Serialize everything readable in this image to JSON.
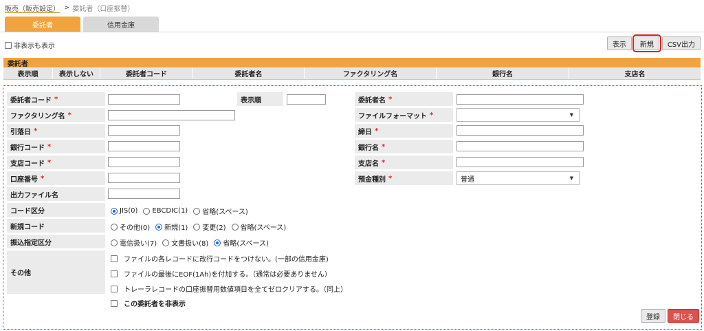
{
  "breadcrumb": {
    "parent": "販売（販売設定）",
    "sep": ">",
    "current": "委託者（口座振替）"
  },
  "tabs": [
    {
      "label": "委託者"
    },
    {
      "label": "信用金庫"
    }
  ],
  "show_hidden": {
    "label": "非表示も表示"
  },
  "toolbar": {
    "display": "表示",
    "new": "新規",
    "csv": "CSV出力"
  },
  "list": {
    "title": "委託者",
    "columns": [
      "表示順",
      "表示しない",
      "委託者コード",
      "委託者名",
      "ファクタリング名",
      "銀行名",
      "支店名"
    ]
  },
  "form": {
    "consignor_code": {
      "label": "委託者コード",
      "required": "*",
      "value": ""
    },
    "display_order": {
      "label": "表示順",
      "value": ""
    },
    "consignor_name": {
      "label": "委託者名",
      "required": "*",
      "value": ""
    },
    "factoring_name": {
      "label": "ファクタリング名",
      "required": "*",
      "value": ""
    },
    "file_format": {
      "label": "ファイルフォーマット",
      "required": "*",
      "value": ""
    },
    "debit_date": {
      "label": "引落日",
      "required": "*",
      "value": ""
    },
    "closing_date": {
      "label": "締日",
      "required": "*",
      "value": ""
    },
    "bank_code": {
      "label": "銀行コード",
      "required": "*",
      "value": ""
    },
    "bank_name": {
      "label": "銀行名",
      "required": "*",
      "value": ""
    },
    "branch_code": {
      "label": "支店コード",
      "required": "*",
      "value": ""
    },
    "branch_name": {
      "label": "支店名",
      "required": "*",
      "value": ""
    },
    "account_number": {
      "label": "口座番号",
      "required": "*",
      "value": ""
    },
    "deposit_type": {
      "label": "預金種別",
      "required": "*",
      "value": "普通"
    },
    "output_filename": {
      "label": "出力ファイル名",
      "value": ""
    },
    "code_type": {
      "label": "コード区分",
      "options": [
        "JIS(0)",
        "EBCDIC(1)",
        "省略(スペース)"
      ],
      "selected": "JIS(0)"
    },
    "new_code": {
      "label": "新規コード",
      "options": [
        "その他(0)",
        "新規(1)",
        "変更(2)",
        "省略(スペース)"
      ],
      "selected": "新規(1)"
    },
    "transfer_type": {
      "label": "振込指定区分",
      "options": [
        "電信扱い(7)",
        "文書扱い(8)",
        "省略(スペース)"
      ],
      "selected": "省略(スペース)"
    },
    "other": {
      "label": "その他",
      "checks": [
        "ファイルの各レコードに改行コードをつけない。(一部の信用金庫)",
        "ファイルの最後にEOF(1Ah)を付加する。（通常は必要ありません）",
        "トレーラレコードの口座振替用数値項目を全てゼロクリアする。（同上）"
      ]
    },
    "hide_consignor": {
      "label": "この委託者を非表示"
    }
  },
  "buttons": {
    "register": "登録",
    "close": "閉じる"
  }
}
